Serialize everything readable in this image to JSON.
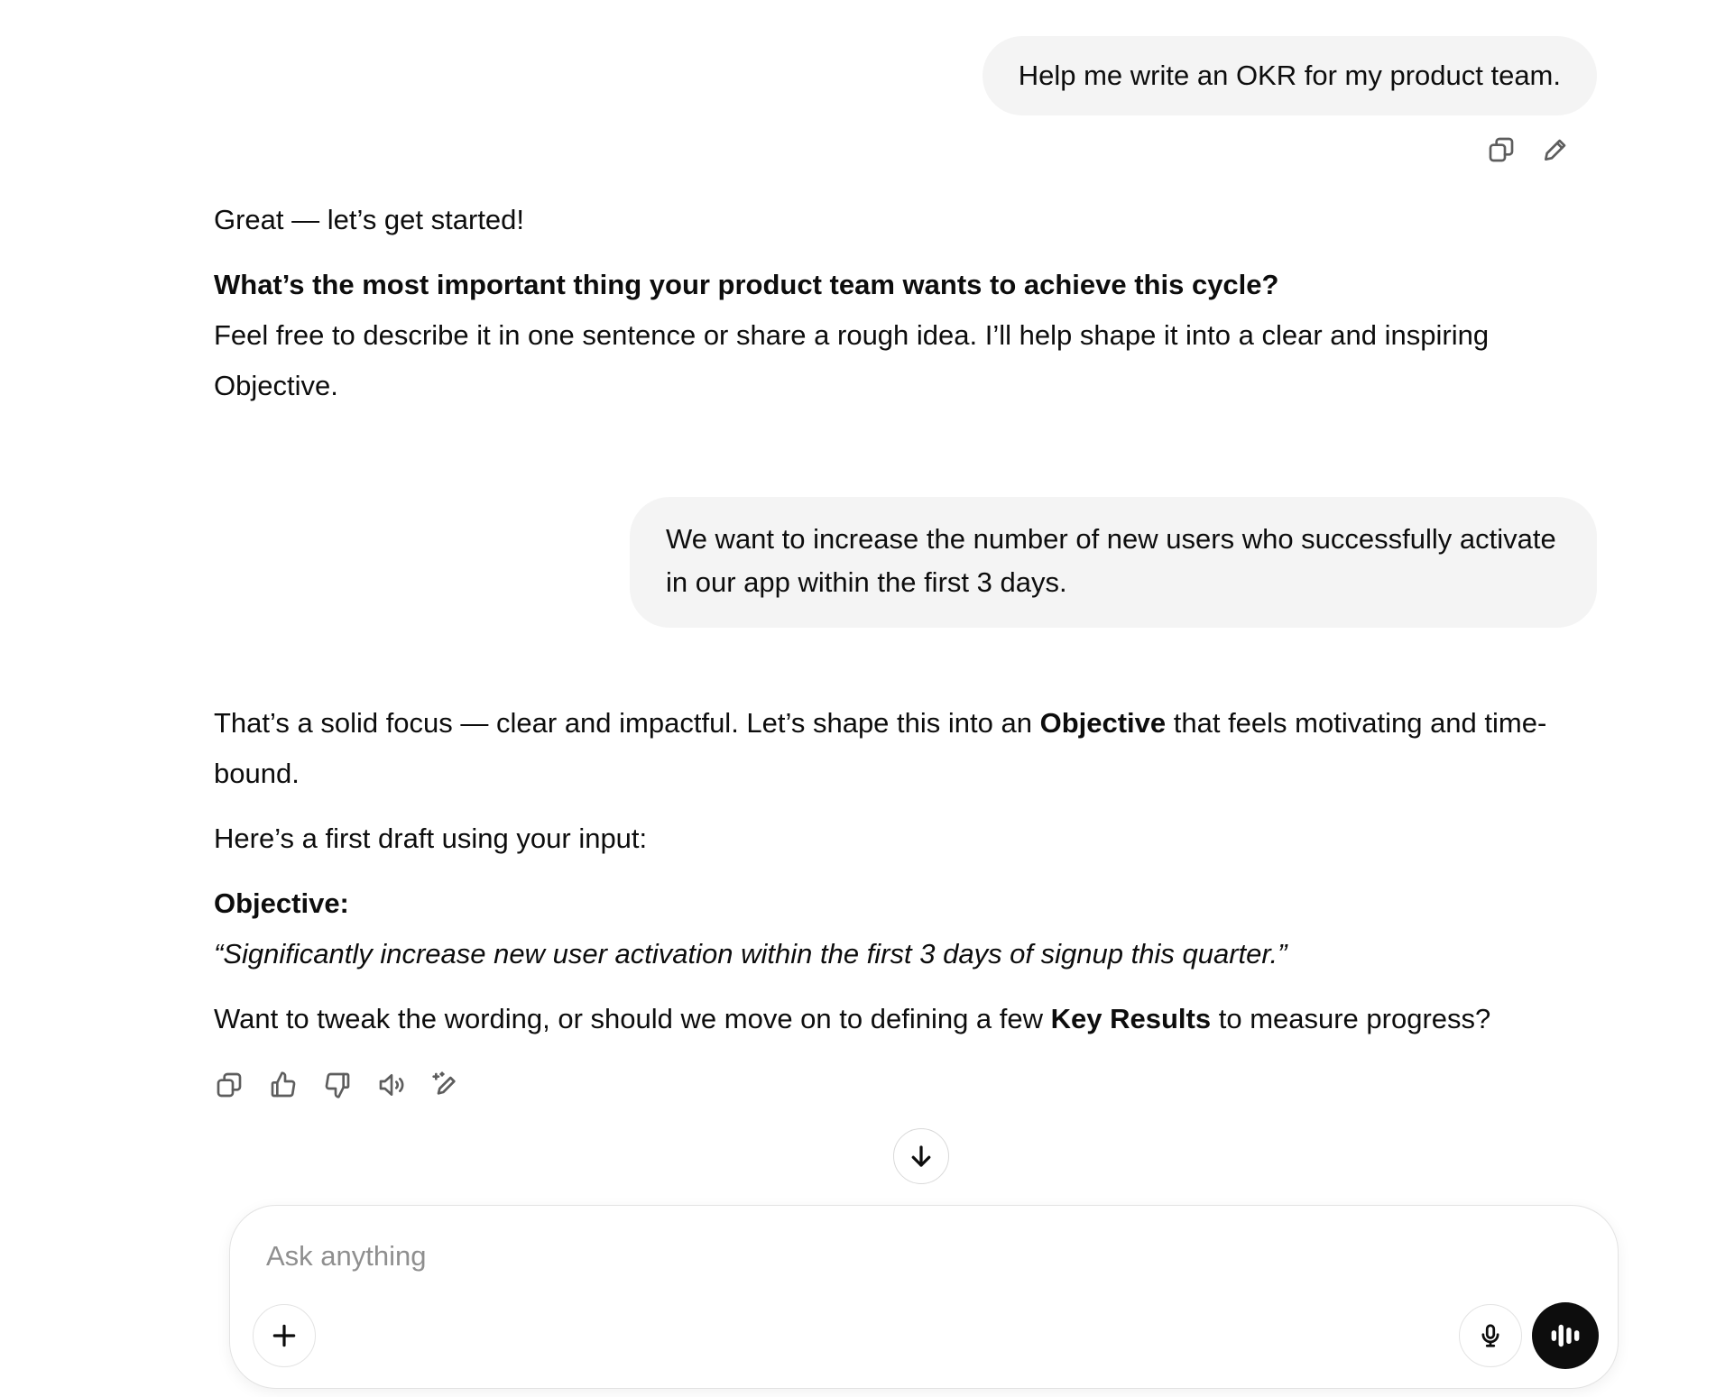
{
  "conversation": {
    "user_message_1": "Help me write an OKR for my product team.",
    "assistant_1": {
      "greeting": "Great — let’s get started!",
      "question": "What’s the most important thing your product team wants to achieve this cycle?",
      "followup": "Feel free to describe it in one sentence or share a rough idea. I’ll help shape it into a clear and inspiring Objective."
    },
    "user_message_2": "We want to increase the number of new users who successfully activate in our app within the first 3 days.",
    "assistant_2": {
      "intro_before": "That’s a solid focus — clear and impactful. Let’s shape this into an ",
      "intro_bold": "Objective",
      "intro_after": " that feels motivating and time-bound.",
      "draft_line": "Here’s a first draft using your input:",
      "objective_label": "Objective:",
      "objective_text": "“Significantly increase new user activation within the first 3 days of signup this quarter.”",
      "closing_before": "Want to tweak the wording, or should we move on to defining a few ",
      "closing_bold": "Key Results",
      "closing_after": " to measure progress?"
    }
  },
  "icons": {
    "user_actions": [
      "copy-icon",
      "edit-icon"
    ],
    "assistant_actions": [
      "copy-icon",
      "thumbs-up-icon",
      "thumbs-down-icon",
      "read-aloud-icon",
      "edit-in-canvas-icon"
    ],
    "scroll": "arrow-down-icon",
    "composer": [
      "plus-icon",
      "microphone-icon",
      "voice-mode-icon"
    ]
  },
  "composer": {
    "placeholder": "Ask anything"
  }
}
